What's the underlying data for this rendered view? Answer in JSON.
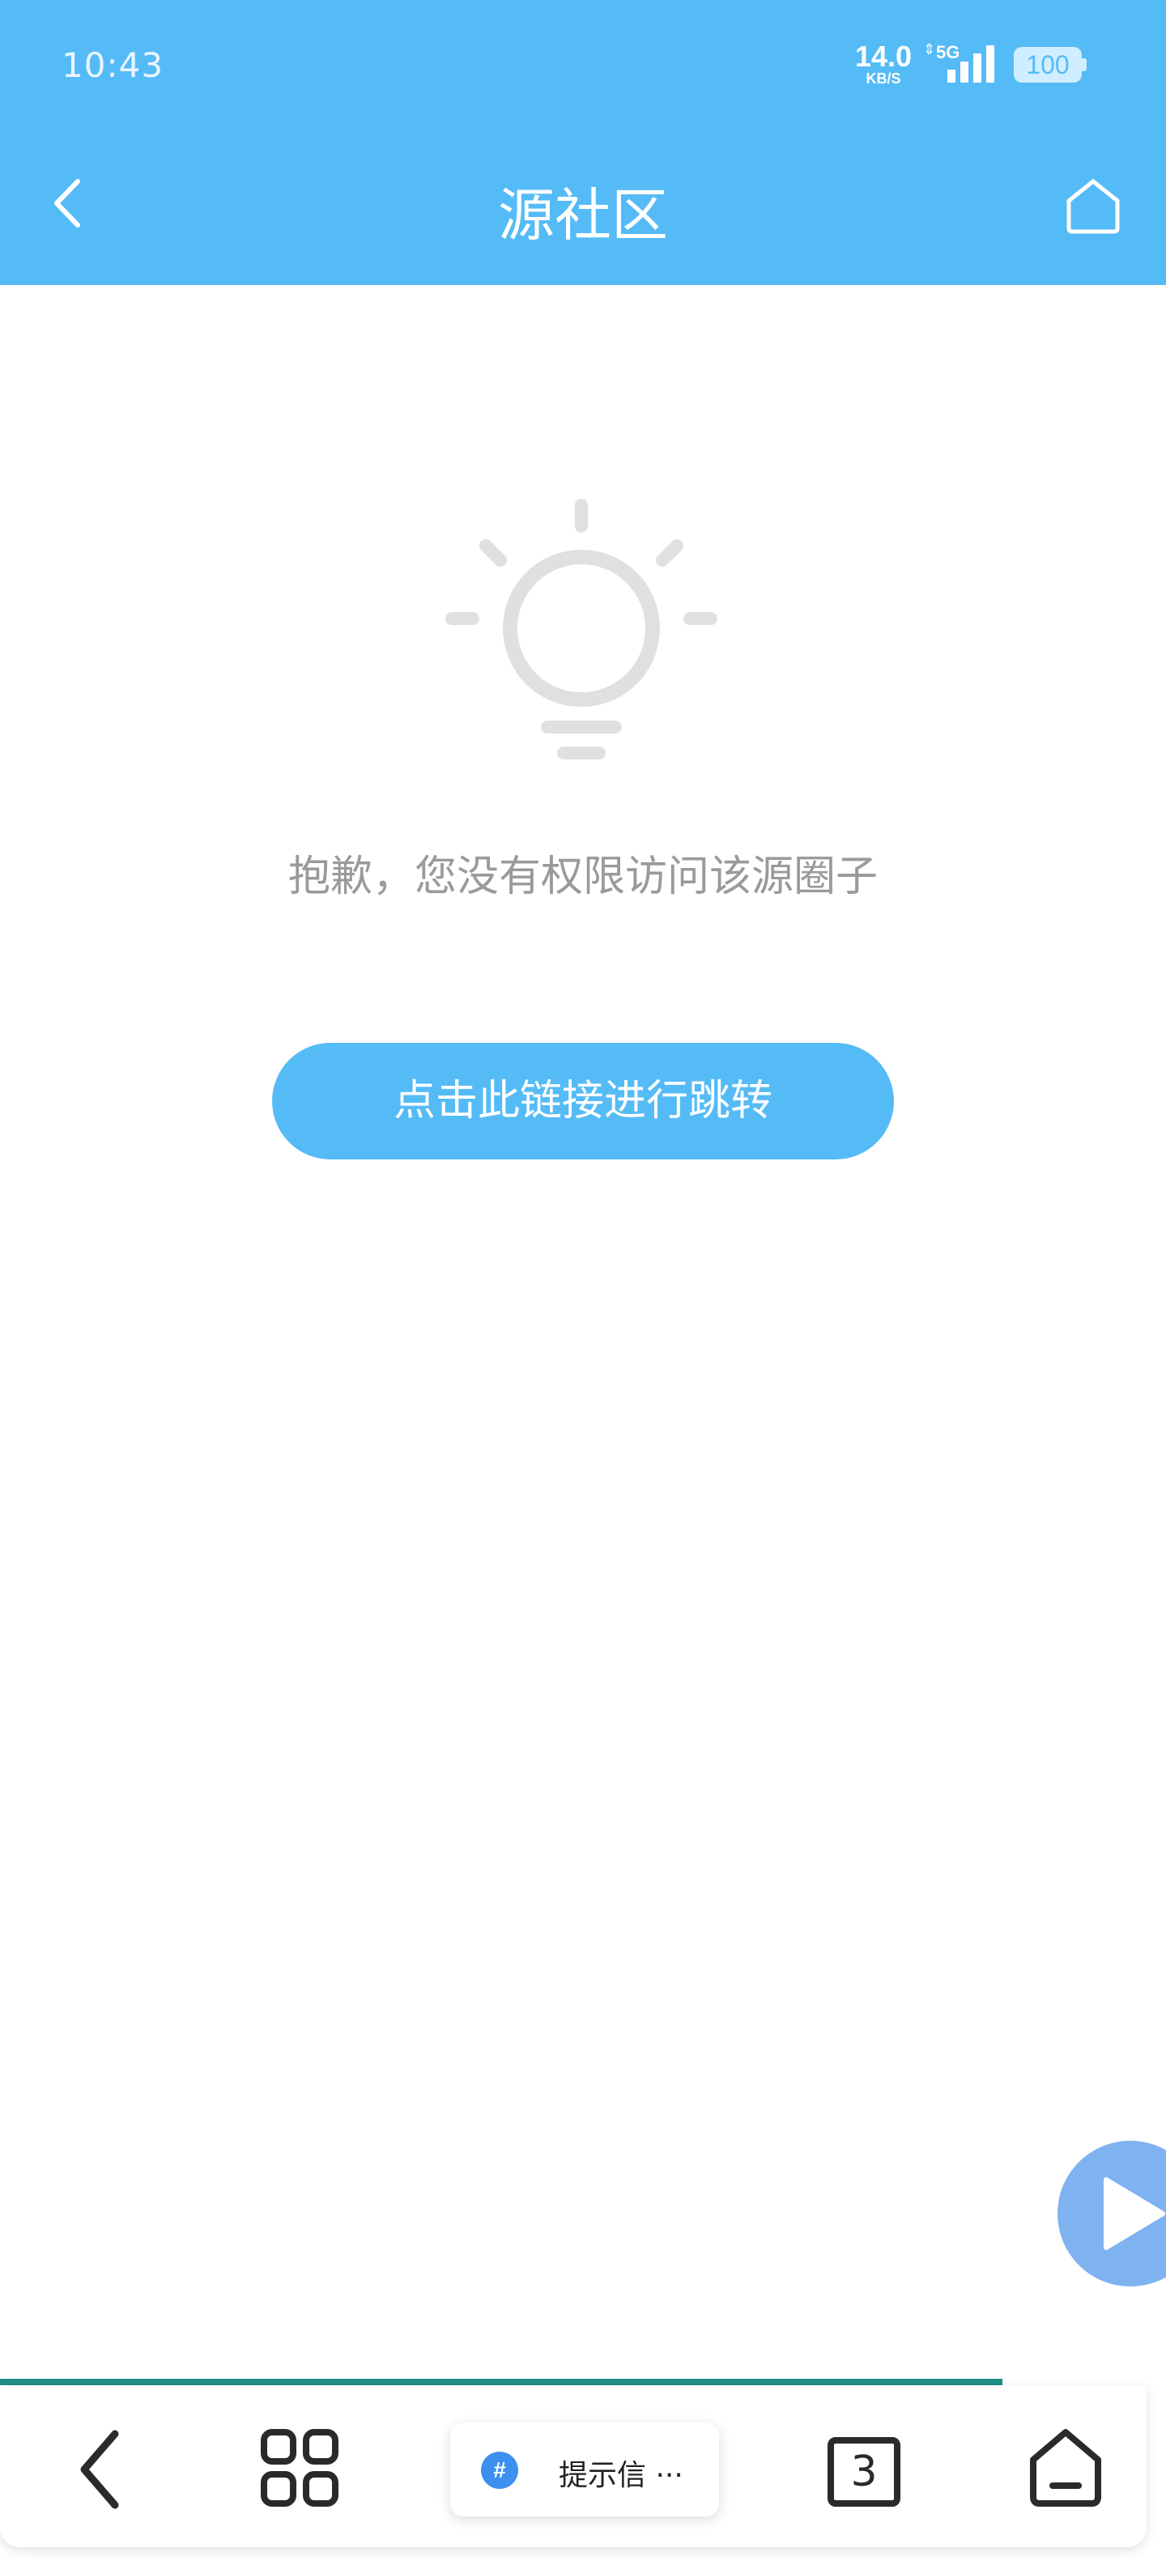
{
  "status_bar": {
    "time": "10:43",
    "net_speed": "14.0",
    "net_unit": "KB/S",
    "network": "5G",
    "battery": "100"
  },
  "header": {
    "title": "源社区",
    "back_icon": "chevron-left-icon",
    "home_icon": "home-icon"
  },
  "empty_state": {
    "icon": "lightbulb-icon",
    "message": "抱歉，您没有权限访问该源圈子",
    "button_label": "点击此链接进行跳转"
  },
  "float_button": {
    "icon": "play-icon"
  },
  "load_progress": {
    "percent": 86
  },
  "bottom_nav": {
    "back_icon": "chevron-left-icon",
    "grid_icon": "grid-icon",
    "center_badge": "#",
    "center_label": "提示信 ···",
    "tab_count": "3",
    "home_icon": "home-icon"
  },
  "colors": {
    "accent": "#55bbf6",
    "message_text": "#9a9a9a",
    "progress": "#1f8f86",
    "float_button": "#7fb2f0"
  }
}
